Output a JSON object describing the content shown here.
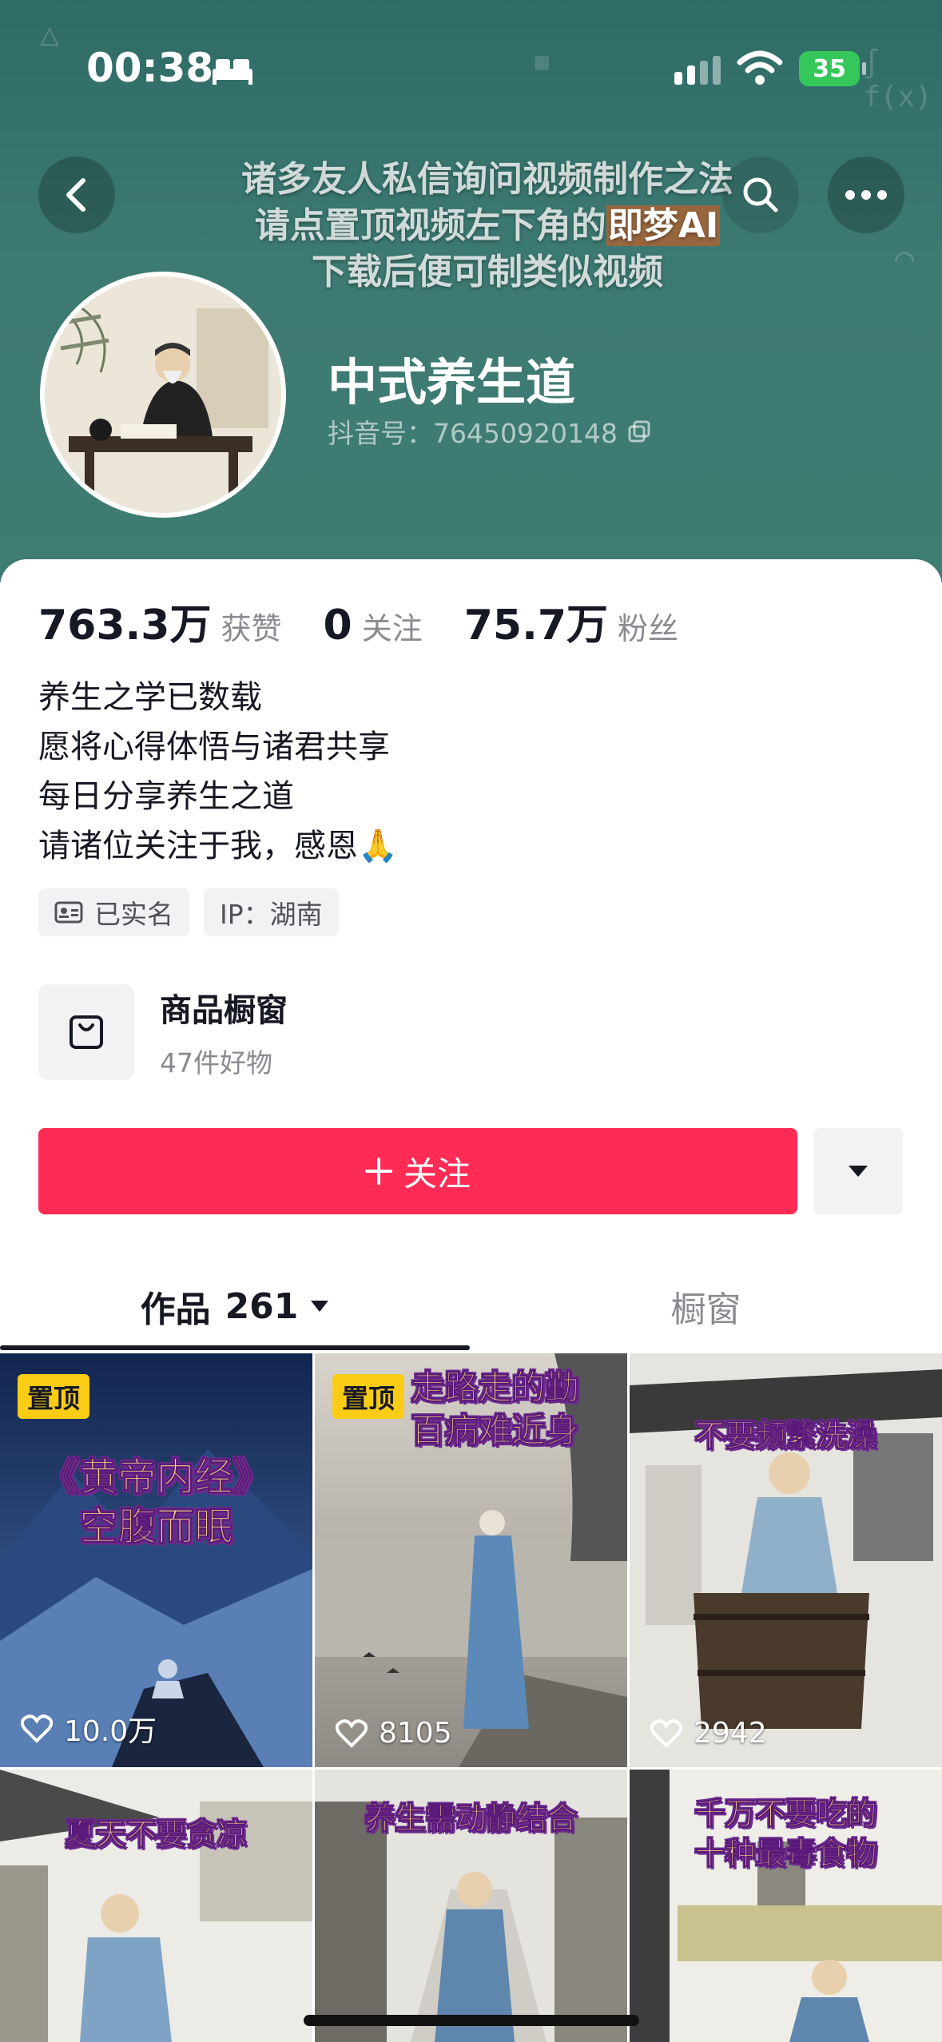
{
  "status_bar": {
    "time": "00:38",
    "battery": "35"
  },
  "header": {
    "notice_lines": [
      "诸多友人私信询问视频制作之法",
      "请点置顶视频左下角的",
      "即梦AI",
      "下载后便可制类似视频"
    ],
    "name": "中式养生道",
    "douyin_id": "抖音号：76450920148"
  },
  "stats": [
    {
      "value": "763.3万",
      "label": "获赞"
    },
    {
      "value": "0",
      "label": "关注"
    },
    {
      "value": "75.7万",
      "label": "粉丝"
    }
  ],
  "bio": [
    "养生之学已数载",
    "愿将心得体悟与诸君共享",
    "每日分享养生之道",
    "请诸位关注于我，感恩🙏"
  ],
  "tags": {
    "verified": "已实名",
    "ip": "IP：湖南"
  },
  "shop": {
    "title": "商品橱窗",
    "subtitle": "47件好物"
  },
  "follow": {
    "label": "关注",
    "icon": "plus-icon"
  },
  "tabs": {
    "works_label": "作品",
    "works_count": "261",
    "window_label": "橱窗"
  },
  "videos": [
    {
      "pinned_label": "置顶",
      "title_lines": [
        "《黄帝内经》",
        "空腹而眠"
      ],
      "likes": "10.0万"
    },
    {
      "pinned_label": "置顶",
      "title_lines": [
        "走路走的勤",
        "百病难近身"
      ],
      "likes": "8105"
    },
    {
      "pinned_label": "",
      "title_lines": [
        "不要频繁洗澡"
      ],
      "likes": "2942"
    },
    {
      "pinned_label": "",
      "title_lines": [
        "夏天不要贪凉"
      ],
      "likes": ""
    },
    {
      "pinned_label": "",
      "title_lines": [
        "养生需动静结合"
      ],
      "likes": ""
    },
    {
      "pinned_label": "",
      "title_lines": [
        "千万不要吃的",
        "十种最毒食物"
      ],
      "likes": ""
    }
  ],
  "colors": {
    "accent": "#fe2c55",
    "pin": "#facc15",
    "header": "#3d7a72"
  }
}
